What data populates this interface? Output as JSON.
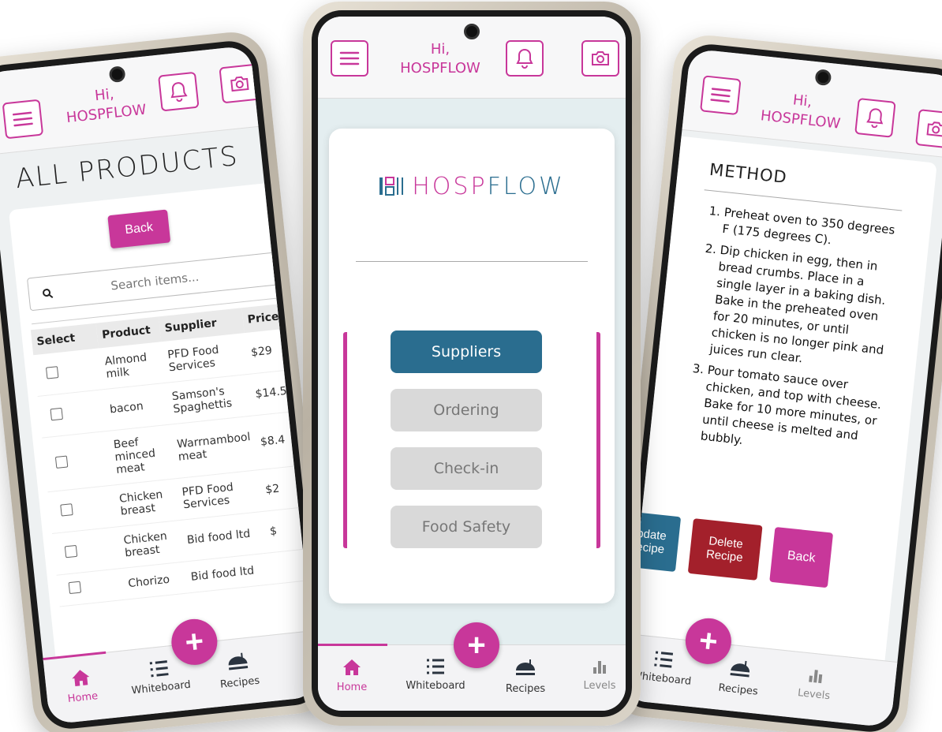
{
  "greeting": {
    "line1": "Hi,",
    "line2": "HOSPFLOW"
  },
  "brand": {
    "accent": "#c8379a",
    "primary": "#2a6d8f",
    "danger": "#a3202b",
    "logo_left": "HOSP",
    "logo_right": "FLOW"
  },
  "center": {
    "menu": [
      {
        "label": "Suppliers"
      },
      {
        "label": "Ordering"
      },
      {
        "label": "Check-in"
      },
      {
        "label": "Food Safety"
      }
    ]
  },
  "nav": {
    "home": "Home",
    "whiteboard": "Whiteboard",
    "recipes": "Recipes",
    "levels": "Levels",
    "fab": "+"
  },
  "left": {
    "title": "ALL PRODUCTS",
    "back": "Back",
    "search_placeholder": "Search items...",
    "headers": {
      "select": "Select",
      "product": "Product",
      "supplier": "Supplier",
      "price": "Price"
    },
    "rows": [
      {
        "product": "Almond milk",
        "supplier": "PFD Food Services",
        "price": "$29"
      },
      {
        "product": "bacon",
        "supplier": "Samson's Spaghettis",
        "price": "$14.5"
      },
      {
        "product": "Beef minced meat",
        "supplier": "Warrnambool meat",
        "price": "$8.4"
      },
      {
        "product": "Chicken breast",
        "supplier": "PFD Food Services",
        "price": "$2"
      },
      {
        "product": "Chicken breast",
        "supplier": "Bid food ltd",
        "price": "$"
      },
      {
        "product": "Chorizo",
        "supplier": "Bid food ltd",
        "price": ""
      }
    ]
  },
  "right": {
    "heading": "METHOD",
    "steps": [
      "Preheat oven to 350 degrees F (175 degrees C).",
      "Dip chicken in egg, then in bread crumbs. Place in a single layer in a baking dish. Bake in the preheated oven for 20 minutes, or until chicken is no longer pink and juices run clear.",
      "Pour tomato sauce over chicken, and top with cheese. Bake for 10 more minutes, or until cheese is melted and bubbly."
    ],
    "update_label": "Update Recipe",
    "delete_label": "Delete Recipe",
    "back_label": "Back"
  }
}
